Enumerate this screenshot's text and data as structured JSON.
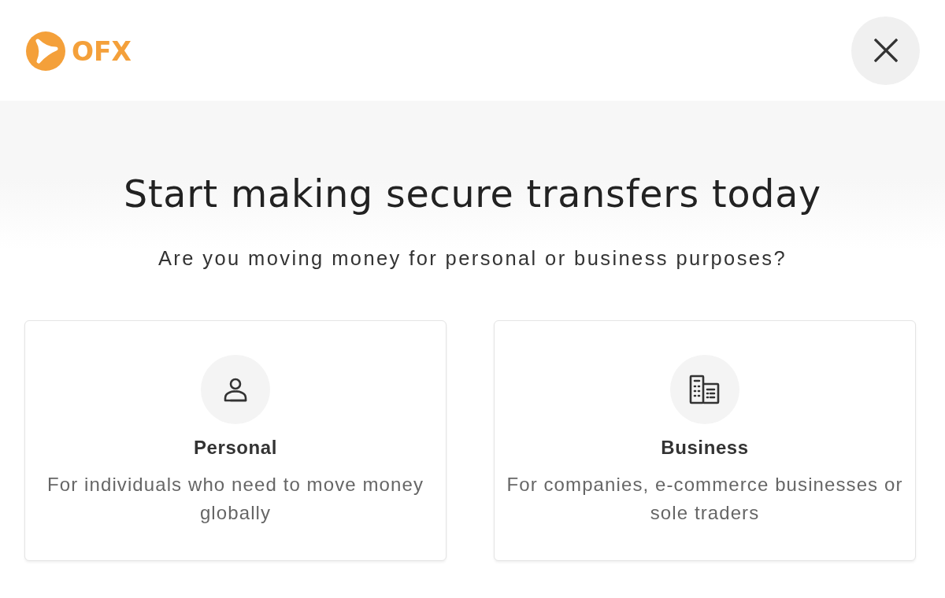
{
  "header": {
    "logo_text": "OFX"
  },
  "title": "Start making secure transfers today",
  "subtitle": "Are you moving money for personal or business purposes?",
  "options": [
    {
      "kind": "personal",
      "title": "Personal",
      "description": "For individuals who need to move money globally"
    },
    {
      "kind": "business",
      "title": "Business",
      "description": "For companies, e-commerce businesses or sole traders"
    }
  ]
}
